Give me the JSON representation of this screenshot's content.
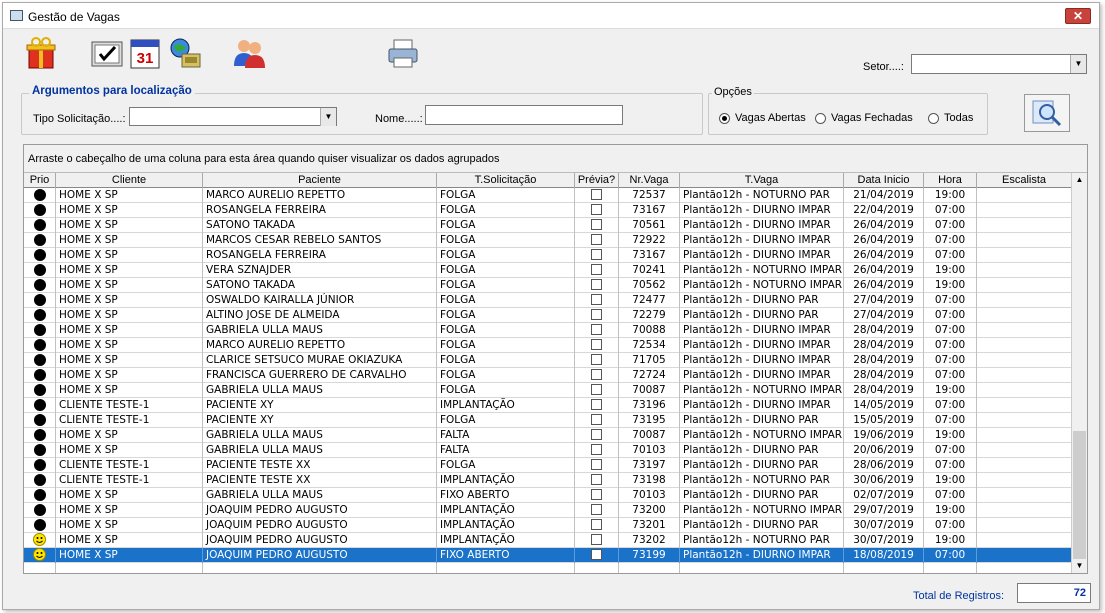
{
  "window": {
    "title": "Gestão de Vagas",
    "close": "✕"
  },
  "toolbar": {
    "icons": [
      "gift-icon",
      "checklist-icon",
      "calendar-icon",
      "globe-phone-icon",
      "users-icon",
      "printer-icon"
    ]
  },
  "setor": {
    "label": "Setor....:",
    "value": ""
  },
  "args": {
    "title": "Argumentos para localização",
    "tipo_label": "Tipo Solicitação....:",
    "tipo_value": "",
    "nome_label": "Nome.....:",
    "nome_value": ""
  },
  "options": {
    "title": "Opções",
    "items": [
      {
        "label": "Vagas Abertas",
        "selected": true
      },
      {
        "label": "Vagas Fechadas",
        "selected": false
      },
      {
        "label": "Todas",
        "selected": false
      }
    ]
  },
  "grid": {
    "group_hint": "Arraste o cabeçalho de uma coluna para esta área quando quiser visualizar os dados agrupados",
    "columns": [
      "Prio",
      "Cliente",
      "Paciente",
      "T.Solicitação",
      "Prévia?",
      "Nr.Vaga",
      "T.Vaga",
      "Data Inicio",
      "Hora",
      "Escalista"
    ],
    "rows": [
      {
        "prio": "dot",
        "cliente": "HOME X SP",
        "paciente": "MARCO AURELIO REPETTO",
        "tipo": "FOLGA",
        "nr": "72537",
        "tvaga": "Plantão12h - NOTURNO PAR",
        "data": "21/04/2019",
        "hora": "19:00"
      },
      {
        "prio": "dot",
        "cliente": "HOME X SP",
        "paciente": "ROSANGELA FERREIRA",
        "tipo": "FOLGA",
        "nr": "73167",
        "tvaga": "Plantão12h - DIURNO IMPAR",
        "data": "22/04/2019",
        "hora": "07:00"
      },
      {
        "prio": "dot",
        "cliente": "HOME X SP",
        "paciente": "SATONO TAKADA",
        "tipo": "FOLGA",
        "nr": "70561",
        "tvaga": "Plantão12h - DIURNO IMPAR",
        "data": "26/04/2019",
        "hora": "07:00"
      },
      {
        "prio": "dot",
        "cliente": "HOME X SP",
        "paciente": "MARCOS CESAR REBELO SANTOS",
        "tipo": "FOLGA",
        "nr": "72922",
        "tvaga": "Plantão12h - DIURNO IMPAR",
        "data": "26/04/2019",
        "hora": "07:00"
      },
      {
        "prio": "dot",
        "cliente": "HOME X SP",
        "paciente": "ROSANGELA FERREIRA",
        "tipo": "FOLGA",
        "nr": "73167",
        "tvaga": "Plantão12h - DIURNO IMPAR",
        "data": "26/04/2019",
        "hora": "07:00"
      },
      {
        "prio": "dot",
        "cliente": "HOME X SP",
        "paciente": "VERA SZNAJDER",
        "tipo": "FOLGA",
        "nr": "70241",
        "tvaga": "Plantão12h - NOTURNO IMPAR",
        "data": "26/04/2019",
        "hora": "19:00"
      },
      {
        "prio": "dot",
        "cliente": "HOME X SP",
        "paciente": "SATONO TAKADA",
        "tipo": "FOLGA",
        "nr": "70562",
        "tvaga": "Plantão12h - NOTURNO IMPAR",
        "data": "26/04/2019",
        "hora": "19:00"
      },
      {
        "prio": "dot",
        "cliente": "HOME X SP",
        "paciente": "OSWALDO KAIRALLA JÚNIOR",
        "tipo": "FOLGA",
        "nr": "72477",
        "tvaga": "Plantão12h - DIURNO PAR",
        "data": "27/04/2019",
        "hora": "07:00"
      },
      {
        "prio": "dot",
        "cliente": "HOME X SP",
        "paciente": "ALTINO JOSE DE ALMEIDA",
        "tipo": "FOLGA",
        "nr": "72279",
        "tvaga": "Plantão12h - DIURNO PAR",
        "data": "27/04/2019",
        "hora": "07:00"
      },
      {
        "prio": "dot",
        "cliente": "HOME X SP",
        "paciente": "GABRIELA ULLA MAUS",
        "tipo": "FOLGA",
        "nr": "70088",
        "tvaga": "Plantão12h - DIURNO IMPAR",
        "data": "28/04/2019",
        "hora": "07:00"
      },
      {
        "prio": "dot",
        "cliente": "HOME X SP",
        "paciente": "MARCO AURELIO REPETTO",
        "tipo": "FOLGA",
        "nr": "72534",
        "tvaga": "Plantão12h - DIURNO IMPAR",
        "data": "28/04/2019",
        "hora": "07:00"
      },
      {
        "prio": "dot",
        "cliente": "HOME X SP",
        "paciente": "CLARICE SETSUCO MURAE OKIAZUKA",
        "tipo": "FOLGA",
        "nr": "71705",
        "tvaga": "Plantão12h - DIURNO IMPAR",
        "data": "28/04/2019",
        "hora": "07:00"
      },
      {
        "prio": "dot",
        "cliente": "HOME X SP",
        "paciente": "FRANCISCA GUERRERO DE CARVALHO",
        "tipo": "FOLGA",
        "nr": "72724",
        "tvaga": "Plantão12h - DIURNO IMPAR",
        "data": "28/04/2019",
        "hora": "07:00"
      },
      {
        "prio": "dot",
        "cliente": "HOME X SP",
        "paciente": "GABRIELA ULLA MAUS",
        "tipo": "FOLGA",
        "nr": "70087",
        "tvaga": "Plantão12h - NOTURNO IMPAR",
        "data": "28/04/2019",
        "hora": "19:00"
      },
      {
        "prio": "dot",
        "cliente": "CLIENTE TESTE-1",
        "paciente": "PACIENTE XY",
        "tipo": "IMPLANTAÇÃO",
        "nr": "73196",
        "tvaga": "Plantão12h - DIURNO IMPAR",
        "data": "14/05/2019",
        "hora": "07:00"
      },
      {
        "prio": "dot",
        "cliente": "CLIENTE TESTE-1",
        "paciente": "PACIENTE XY",
        "tipo": "FOLGA",
        "nr": "73195",
        "tvaga": "Plantão12h - DIURNO PAR",
        "data": "15/05/2019",
        "hora": "07:00"
      },
      {
        "prio": "dot",
        "cliente": "HOME X SP",
        "paciente": "GABRIELA ULLA MAUS",
        "tipo": "FALTA",
        "nr": "70087",
        "tvaga": "Plantão12h - NOTURNO IMPAR",
        "data": "19/06/2019",
        "hora": "19:00"
      },
      {
        "prio": "dot",
        "cliente": "HOME X SP",
        "paciente": "GABRIELA ULLA MAUS",
        "tipo": "FALTA",
        "nr": "70103",
        "tvaga": "Plantão12h - DIURNO PAR",
        "data": "20/06/2019",
        "hora": "07:00"
      },
      {
        "prio": "dot",
        "cliente": "CLIENTE TESTE-1",
        "paciente": "PACIENTE TESTE XX",
        "tipo": "FOLGA",
        "nr": "73197",
        "tvaga": "Plantão12h - DIURNO PAR",
        "data": "28/06/2019",
        "hora": "07:00"
      },
      {
        "prio": "dot",
        "cliente": "CLIENTE TESTE-1",
        "paciente": "PACIENTE TESTE XX",
        "tipo": "IMPLANTAÇÃO",
        "nr": "73198",
        "tvaga": "Plantão12h - NOTURNO PAR",
        "data": "30/06/2019",
        "hora": "19:00"
      },
      {
        "prio": "dot",
        "cliente": "HOME X SP",
        "paciente": "GABRIELA ULLA MAUS",
        "tipo": "FIXO ABERTO",
        "nr": "70103",
        "tvaga": "Plantão12h - DIURNO PAR",
        "data": "02/07/2019",
        "hora": "07:00"
      },
      {
        "prio": "dot",
        "cliente": "HOME X SP",
        "paciente": "JOAQUIM PEDRO AUGUSTO",
        "tipo": "IMPLANTAÇÃO",
        "nr": "73200",
        "tvaga": "Plantão12h - NOTURNO IMPAR",
        "data": "29/07/2019",
        "hora": "19:00"
      },
      {
        "prio": "dot",
        "cliente": "HOME X SP",
        "paciente": "JOAQUIM PEDRO AUGUSTO",
        "tipo": "IMPLANTAÇÃO",
        "nr": "73201",
        "tvaga": "Plantão12h - DIURNO PAR",
        "data": "30/07/2019",
        "hora": "07:00"
      },
      {
        "prio": "smiley",
        "cliente": "HOME X SP",
        "paciente": "JOAQUIM PEDRO AUGUSTO",
        "tipo": "IMPLANTAÇÃO",
        "nr": "73202",
        "tvaga": "Plantão12h - NOTURNO PAR",
        "data": "30/07/2019",
        "hora": "19:00"
      },
      {
        "prio": "smiley",
        "cliente": "HOME X SP",
        "paciente": "JOAQUIM PEDRO AUGUSTO",
        "tipo": "FIXO ABERTO",
        "nr": "73199",
        "tvaga": "Plantão12h - DIURNO IMPAR",
        "data": "18/08/2019",
        "hora": "07:00",
        "selected": true
      },
      {
        "prio": "",
        "cliente": "",
        "paciente": "",
        "tipo": "",
        "nr": "",
        "tvaga": "",
        "data": "",
        "hora": "",
        "blank": true
      }
    ]
  },
  "footer": {
    "total_label": "Total de Registros:",
    "total_value": "72"
  },
  "colors": {
    "selection": "#1a72c9",
    "accent_text": "#0033a0",
    "smiley": "#ffe600"
  }
}
